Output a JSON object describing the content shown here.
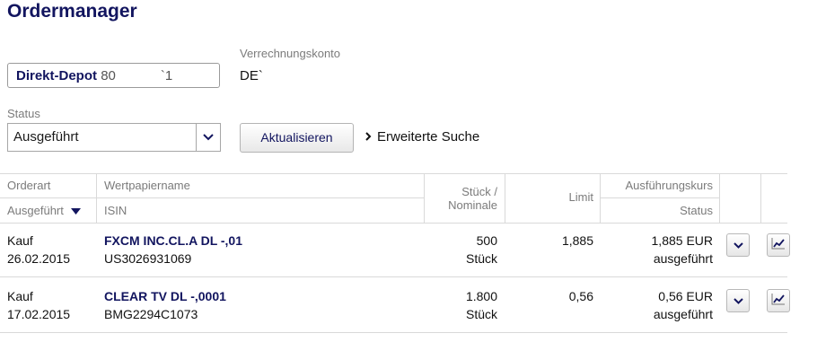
{
  "page_title": "Ordermanager",
  "depot": {
    "label": "Direkt-Depot",
    "number": "80            `1"
  },
  "account": {
    "label": "Verrechnungskonto",
    "value": "DE`"
  },
  "status": {
    "label": "Status",
    "selected": "Ausgeführt"
  },
  "refresh_button": "Aktualisieren",
  "extended_search": "Erweiterte Suche",
  "table": {
    "headers": {
      "orderart": "Orderart",
      "filter": "Ausgeführt",
      "wertpapiername": "Wertpapiername",
      "isin": "ISIN",
      "stueck": "Stück /",
      "nominale": "Nominale",
      "limit": "Limit",
      "ausfuehrungskurs": "Ausführungskurs",
      "status": "Status"
    },
    "rows": [
      {
        "type": "Kauf",
        "date": "26.02.2015",
        "name": "FXCM INC.CL.A DL -,01",
        "isin": "US3026931069",
        "qty": "500",
        "unit": "Stück",
        "limit": "1,885",
        "price": "1,885 EUR",
        "status": "ausgeführt"
      },
      {
        "type": "Kauf",
        "date": "17.02.2015",
        "name": "CLEAR TV DL -,0001",
        "isin": "BMG2294C1073",
        "qty": "1.800",
        "unit": "Stück",
        "limit": "0,56",
        "price": "0,56 EUR",
        "status": "ausgeführt"
      }
    ]
  },
  "icons": {
    "dropdown": "chevron-down-icon",
    "chart": "chart-icon",
    "sort": "sort-down-icon",
    "link": "chevron-right-icon"
  },
  "colors": {
    "brand": "#12155f",
    "muted": "#7b7b7b",
    "border": "#d9d9d9"
  }
}
